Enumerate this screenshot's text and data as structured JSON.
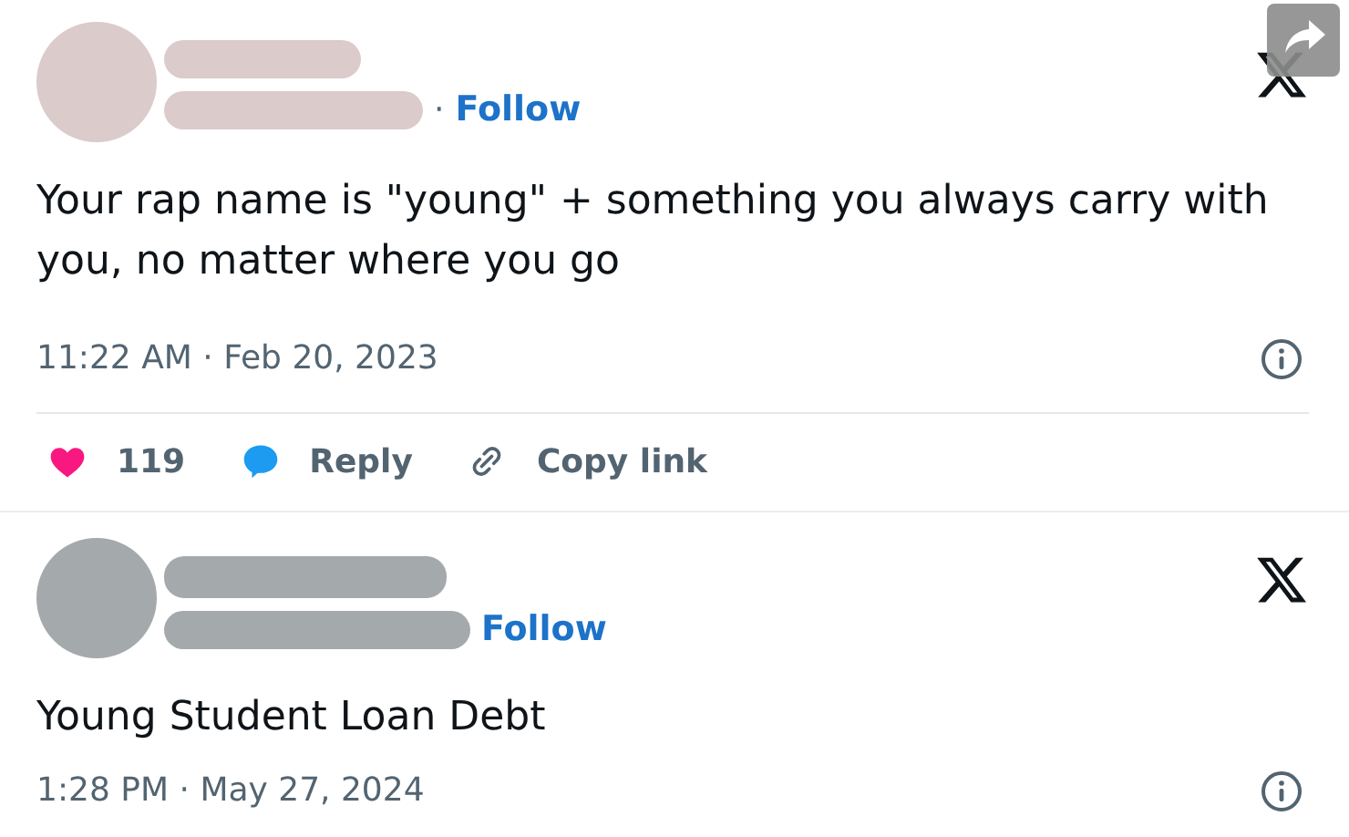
{
  "posts": [
    {
      "color": "#dccbcb",
      "follow": {
        "separator": "·",
        "label": "Follow"
      },
      "share_overlay": true,
      "text": "Your rap name is \"young\" + something you always carry with you, no matter where you go",
      "timestamp": "11:22 AM · Feb 20, 2023",
      "actions": [
        {
          "kind": "like",
          "label": "119"
        },
        {
          "kind": "reply",
          "label": "Reply"
        },
        {
          "kind": "copy",
          "label": "Copy link"
        }
      ]
    },
    {
      "color": "#a4a9ac",
      "follow": {
        "label": "Follow"
      },
      "share_overlay": false,
      "text": "Young Student Loan Debt",
      "timestamp": "1:28 PM · May 27, 2024"
    }
  ]
}
